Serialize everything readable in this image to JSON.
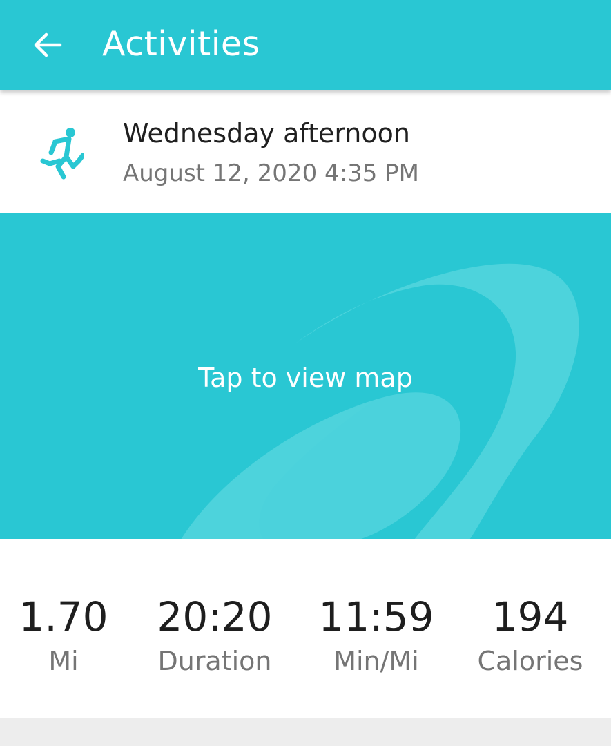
{
  "app_bar": {
    "title": "Activities",
    "back_icon": "arrow-left-icon",
    "background_color": "#29C7D3"
  },
  "activity": {
    "icon": "running-person-icon",
    "name": "Wednesday afternoon",
    "datetime": "August 12, 2020 4:35 PM"
  },
  "map": {
    "label": "Tap to view map"
  },
  "stats": [
    {
      "value": "1.70",
      "label": "Mi"
    },
    {
      "value": "20:20",
      "label": "Duration"
    },
    {
      "value": "11:59",
      "label": "Min/Mi"
    },
    {
      "value": "194",
      "label": "Calories"
    }
  ]
}
